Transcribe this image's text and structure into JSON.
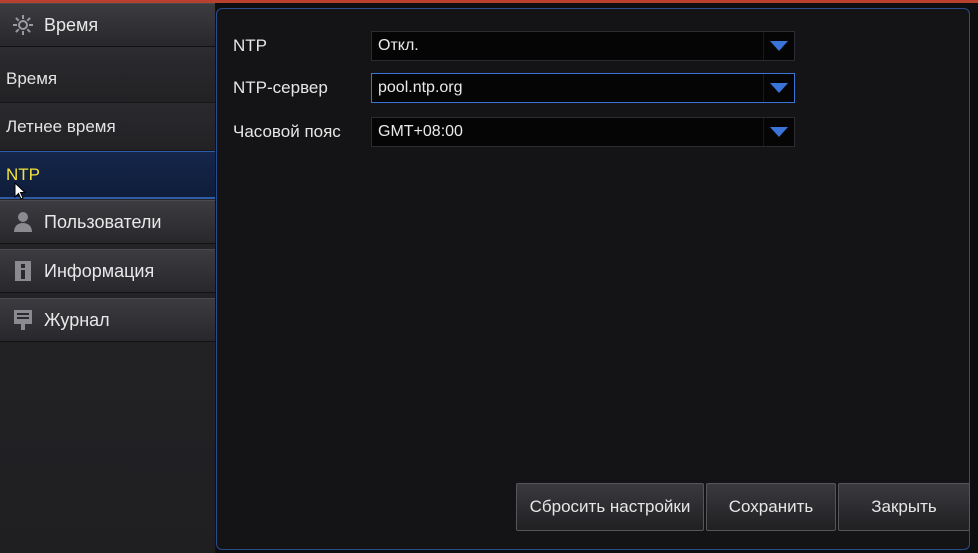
{
  "sidebar": {
    "groups": [
      {
        "label": "Время",
        "icon": "gear-icon"
      },
      {
        "label": "Пользователи",
        "icon": "user-icon"
      },
      {
        "label": "Информация",
        "icon": "info-icon"
      },
      {
        "label": "Журнал",
        "icon": "log-icon"
      }
    ],
    "sub_items": [
      {
        "label": "Время"
      },
      {
        "label": "Летнее время"
      },
      {
        "label": "NTP",
        "active": true
      }
    ]
  },
  "form": {
    "ntp": {
      "label": "NTP",
      "value": "Откл."
    },
    "server": {
      "label": "NTP-сервер",
      "value": "pool.ntp.org"
    },
    "timezone": {
      "label": "Часовой пояс",
      "value": "GMT+08:00"
    }
  },
  "buttons": {
    "reset": "Сбросить настройки",
    "save": "Сохранить",
    "close": "Закрыть"
  },
  "colors": {
    "accent": "#3a74d8",
    "active_text": "#f4e23a",
    "panel_border": "#2a4c8a",
    "top_bar": "#b8412d"
  }
}
